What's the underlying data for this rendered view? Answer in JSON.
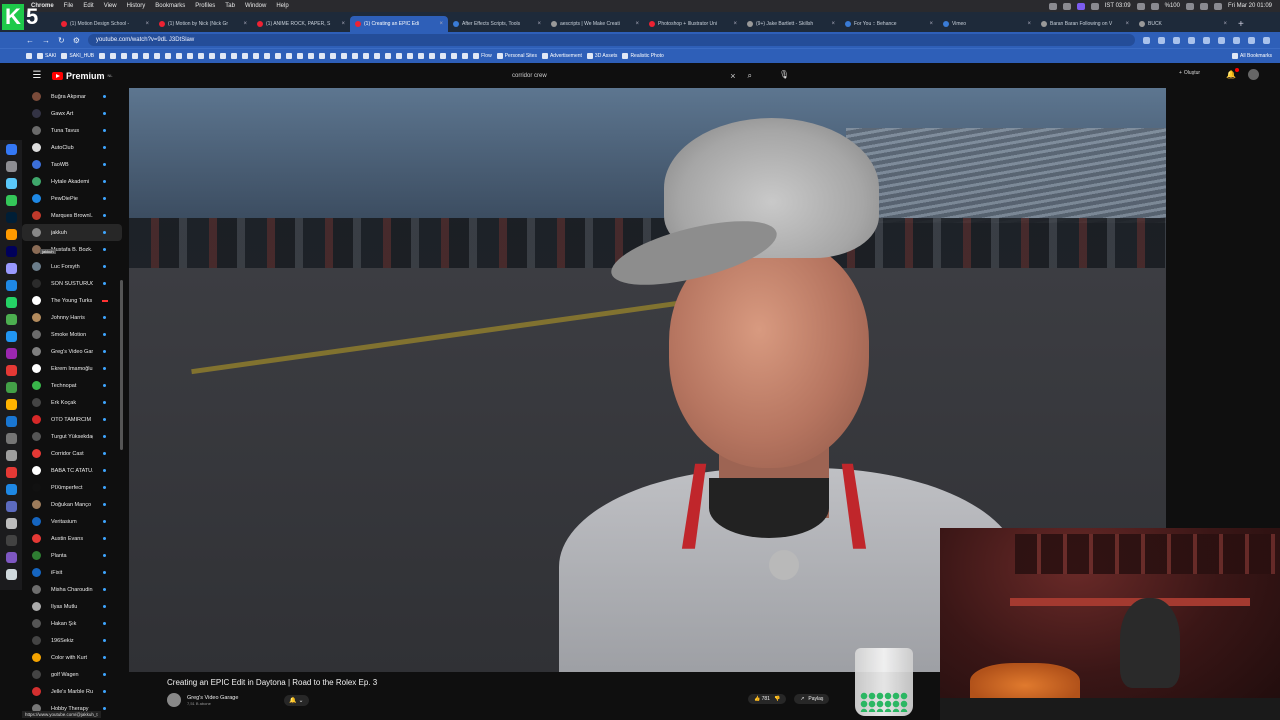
{
  "menubar": {
    "app": "Chrome",
    "items": [
      "File",
      "Edit",
      "View",
      "History",
      "Bookmarks",
      "Profiles",
      "Tab",
      "Window",
      "Help"
    ],
    "clock_ist": "IST 03:09",
    "battery": "%100",
    "date_time": "Fri Mar 20  01:09"
  },
  "overlay_logo": {
    "letter": "K",
    "number": "5"
  },
  "tabs": [
    {
      "title": "(1) Motion Design School -",
      "fav": "red"
    },
    {
      "title": "(1) Motion by Nick (Nick Gr",
      "fav": "red"
    },
    {
      "title": "(1) ANIME ROCK, PAPER, S",
      "fav": "red"
    },
    {
      "title": "(1) Creating an EPIC Edi",
      "fav": "red",
      "active": true
    },
    {
      "title": "After Effects Scripts, Tools",
      "fav": "blue"
    },
    {
      "title": "aescripts | We Make Creati",
      "fav": "grey"
    },
    {
      "title": "Photoshop + Illustrator Uni",
      "fav": "red"
    },
    {
      "title": "(9+) Jake Bartlett - Skillsh",
      "fav": "grey"
    },
    {
      "title": "For You :: Behance",
      "fav": "blue"
    },
    {
      "title": "Vimeo",
      "fav": "blue"
    },
    {
      "title": "Baran Baran Following on V",
      "fav": "grey"
    },
    {
      "title": "BUCK",
      "fav": "grey"
    }
  ],
  "address": {
    "url": "youtube.com/watch?v=9dL J3DtSlaw"
  },
  "bookmarks": {
    "items": [
      "SAKI",
      "SAKI_HUB",
      "Flow",
      "Personal Sites",
      "Advertisement",
      "3D Assets",
      "Realistic Photo"
    ],
    "all": "All Bookmarks"
  },
  "youtube": {
    "brand": "Premium",
    "brand_sup": "NL",
    "search_query": "corridor crew",
    "create_label": "Oluştur"
  },
  "subscriptions": [
    {
      "name": "Buğra Akpınar",
      "color": "#7a4b3a"
    },
    {
      "name": "Gawx Art",
      "color": "#333344"
    },
    {
      "name": "Tuna Tavus",
      "color": "#6a6a6a"
    },
    {
      "name": "AutoClub",
      "color": "#dddddd"
    },
    {
      "name": "TaoWB",
      "color": "#3c6fd8"
    },
    {
      "name": "Hytale Akademi",
      "color": "#3fa76b"
    },
    {
      "name": "PewDiePie",
      "color": "#1e88e5"
    },
    {
      "name": "Marques Brownl...",
      "color": "#c0392b"
    },
    {
      "name": "jakkuh",
      "color": "#888888",
      "hover": true
    },
    {
      "name": "Mustafa B. Bozk...",
      "color": "#8a6b55"
    },
    {
      "name": "Luc Forsyth",
      "color": "#6b7d8a"
    },
    {
      "name": "SON SUSTURUCU",
      "color": "#2b2b2b"
    },
    {
      "name": "The Young Turks",
      "color": "#ffffff",
      "live": true
    },
    {
      "name": "Johnny Harris",
      "color": "#b38b5d"
    },
    {
      "name": "Smoke Motion",
      "color": "#6b6b6b"
    },
    {
      "name": "Greg's Video Garage",
      "color": "#7f7f7f"
    },
    {
      "name": "Ekrem İmamoğlu",
      "color": "#ffffff"
    },
    {
      "name": "Technopat",
      "color": "#39b54a"
    },
    {
      "name": "Erk Koçak",
      "color": "#444444"
    },
    {
      "name": "OTO TAMİRCİM",
      "color": "#d62828"
    },
    {
      "name": "Turgut Yüksekdağ",
      "color": "#555555"
    },
    {
      "name": "Corridor Cast",
      "color": "#e53935"
    },
    {
      "name": "BABA TC ATATÜ...",
      "color": "#ffffff"
    },
    {
      "name": "PIXimperfect",
      "color": "#111111"
    },
    {
      "name": "Doğukan Manço",
      "color": "#9c7b5b"
    },
    {
      "name": "Veritasium",
      "color": "#1565c0"
    },
    {
      "name": "Austin Evans",
      "color": "#e53935"
    },
    {
      "name": "Planta",
      "color": "#2e7d32"
    },
    {
      "name": "iFixit",
      "color": "#1565c0"
    },
    {
      "name": "Misha Charoudin",
      "color": "#6d6d6d"
    },
    {
      "name": "İlyas Mutlu",
      "color": "#aaaaaa"
    },
    {
      "name": "Hakan Şık",
      "color": "#555555"
    },
    {
      "name": "196Sekiz",
      "color": "#444444"
    },
    {
      "name": "Color with Kurt",
      "color": "#f4a300"
    },
    {
      "name": "golf Wagen",
      "color": "#444444"
    },
    {
      "name": "Jelle's Marble Ru...",
      "color": "#d32f2f"
    },
    {
      "name": "Hobby Therapy",
      "color": "#777777"
    }
  ],
  "tooltip": "jakkuh",
  "status_url": "https://www.youtube.com/@jakkuh_t",
  "video": {
    "title": "Creating an EPIC Edit in Daytona | Road to the Rolex Ep. 3",
    "channel": "Greg's Video Garage",
    "subscribers": "7,51 B abone",
    "likes": "781",
    "share": "Paylaş"
  }
}
